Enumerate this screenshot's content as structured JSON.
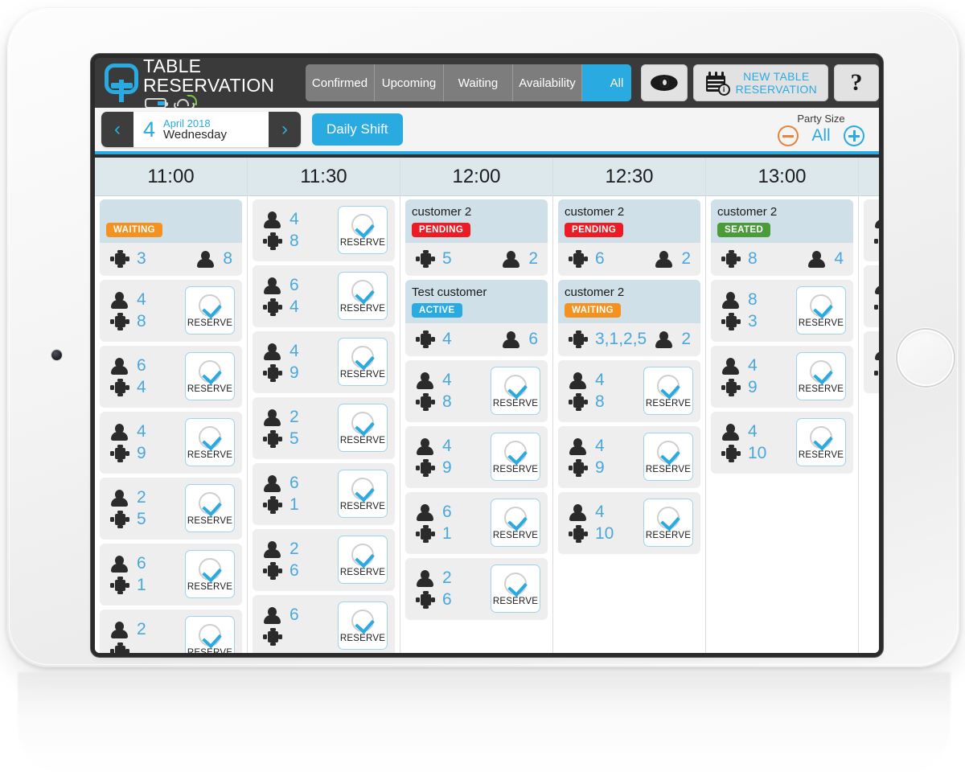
{
  "app": {
    "brand_title": "TABLE RESERVATION",
    "logo_icon": "q-table-logo-icon",
    "battery_icon": "battery-icon",
    "cloud_icon": "cloud-wifi-icon"
  },
  "header": {
    "tabs": [
      {
        "label": "Confirmed",
        "active": false
      },
      {
        "label": "Upcoming",
        "active": false
      },
      {
        "label": "Waiting",
        "active": false
      },
      {
        "label": "Availability",
        "active": false
      },
      {
        "label": "All",
        "active": true
      }
    ],
    "eye_button": {
      "icon": "eye-icon"
    },
    "new_reservation": {
      "line1": "NEW TABLE",
      "line2": "RESERVATION",
      "icon": "calendar-info-icon"
    },
    "help_button": {
      "label": "?"
    }
  },
  "datebar": {
    "prev_label": "‹",
    "next_label": "›",
    "day_number": "4",
    "month_year": "April 2018",
    "weekday": "Wednesday",
    "shift_label": "Daily Shift",
    "party_size_label": "Party Size",
    "party_size_value": "All",
    "minus_icon": "minus-circle-icon",
    "plus_icon": "plus-circle-icon"
  },
  "colors": {
    "accent": "#29abe2",
    "waiting": "#f5911e",
    "pending": "#ed1c24",
    "active": "#29abe2",
    "seated": "#4b9b3a",
    "header_bar": "#3a3a3a",
    "column_head": "#dde8ed",
    "card_top": "#cfe0e8",
    "card_body": "#eeeeee"
  },
  "labels": {
    "reserve": "RESERVE",
    "table_icon": "table-icon",
    "person_icon": "person-icon",
    "check_icon": "check-circle-icon"
  },
  "columns": [
    {
      "time": "11:00",
      "cards": [
        {
          "type": "booking",
          "customer": "",
          "status": "WAITING",
          "status_key": "waiting",
          "table": "3",
          "guests": "8"
        },
        {
          "type": "slot",
          "guests": "4",
          "table": "8"
        },
        {
          "type": "slot",
          "guests": "6",
          "table": "4"
        },
        {
          "type": "slot",
          "guests": "4",
          "table": "9"
        },
        {
          "type": "slot",
          "guests": "2",
          "table": "5"
        },
        {
          "type": "slot",
          "guests": "6",
          "table": "1"
        },
        {
          "type": "slot",
          "guests": "2",
          "table": ""
        }
      ]
    },
    {
      "time": "11:30",
      "cards": [
        {
          "type": "slot",
          "guests": "4",
          "table": "8"
        },
        {
          "type": "slot",
          "guests": "6",
          "table": "4"
        },
        {
          "type": "slot",
          "guests": "4",
          "table": "9"
        },
        {
          "type": "slot",
          "guests": "2",
          "table": "5"
        },
        {
          "type": "slot",
          "guests": "6",
          "table": "1"
        },
        {
          "type": "slot",
          "guests": "2",
          "table": "6"
        },
        {
          "type": "slot",
          "guests": "6",
          "table": ""
        }
      ]
    },
    {
      "time": "12:00",
      "cards": [
        {
          "type": "booking",
          "customer": "customer 2",
          "status": "PENDING",
          "status_key": "pending",
          "table": "5",
          "guests": "2"
        },
        {
          "type": "booking",
          "customer": "Test customer",
          "status": "ACTIVE",
          "status_key": "active",
          "table": "4",
          "guests": "6"
        },
        {
          "type": "slot",
          "guests": "4",
          "table": "8"
        },
        {
          "type": "slot",
          "guests": "4",
          "table": "9"
        },
        {
          "type": "slot",
          "guests": "6",
          "table": "1"
        },
        {
          "type": "slot",
          "guests": "2",
          "table": "6"
        }
      ]
    },
    {
      "time": "12:30",
      "cards": [
        {
          "type": "booking",
          "customer": "customer 2",
          "status": "PENDING",
          "status_key": "pending",
          "table": "6",
          "guests": "2"
        },
        {
          "type": "booking",
          "customer": "customer 2",
          "status": "WAITING",
          "status_key": "waiting",
          "table": "3,1,2,5",
          "guests": "2"
        },
        {
          "type": "slot",
          "guests": "4",
          "table": "8"
        },
        {
          "type": "slot",
          "guests": "4",
          "table": "9"
        },
        {
          "type": "slot",
          "guests": "4",
          "table": "10"
        }
      ]
    },
    {
      "time": "13:00",
      "cards": [
        {
          "type": "booking",
          "customer": "customer 2",
          "status": "SEATED",
          "status_key": "seated",
          "table": "8",
          "guests": "4"
        },
        {
          "type": "slot",
          "guests": "8",
          "table": "3"
        },
        {
          "type": "slot",
          "guests": "4",
          "table": "9"
        },
        {
          "type": "slot",
          "guests": "4",
          "table": "10"
        }
      ]
    },
    {
      "time": "",
      "partial": true,
      "cards": [
        {
          "type": "slot",
          "guests": "",
          "table": ""
        },
        {
          "type": "slot",
          "guests": "",
          "table": ""
        },
        {
          "type": "slot",
          "guests": "",
          "table": ""
        }
      ]
    }
  ]
}
